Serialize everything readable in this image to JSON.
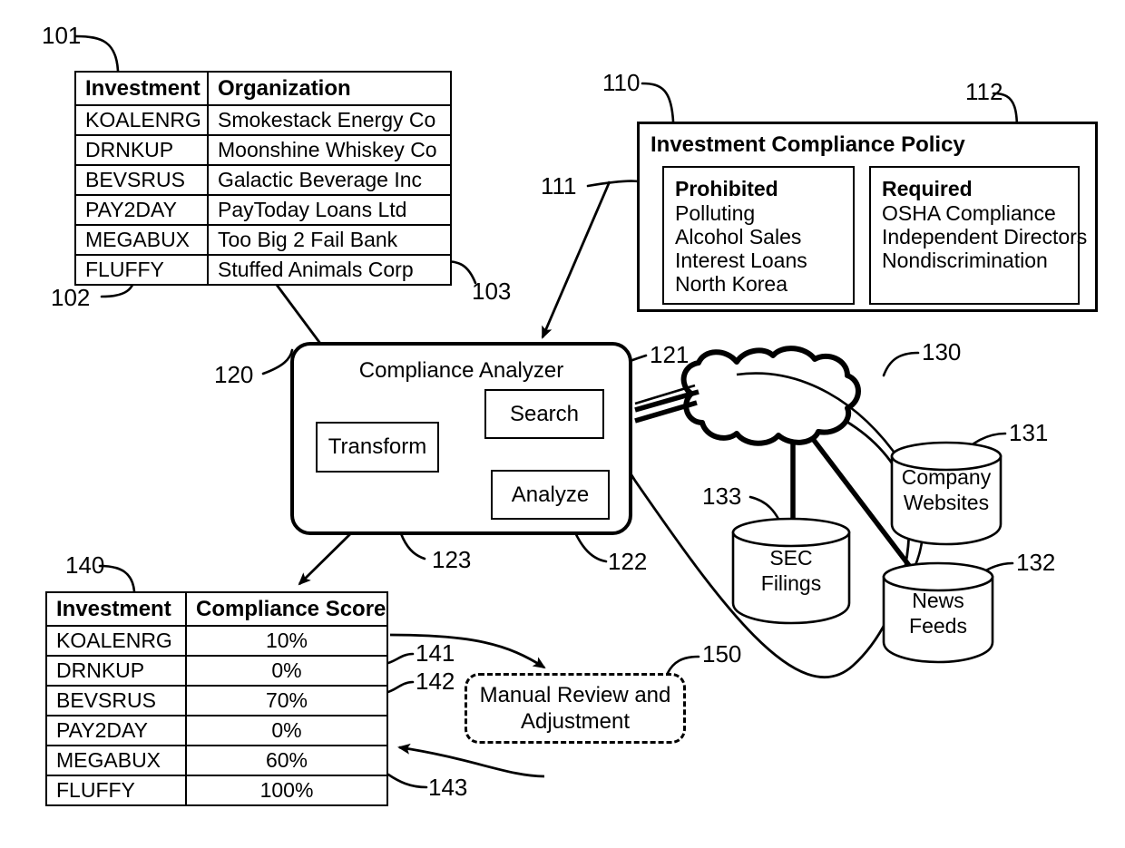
{
  "figure": {
    "type": "patent-flow-diagram",
    "investment_table": {
      "ref": "101",
      "ref_left": "102",
      "ref_right": "103",
      "headers": [
        "Investment",
        "Organization"
      ],
      "rows": [
        [
          "KOALENRG",
          "Smokestack Energy Co"
        ],
        [
          "DRNKUP",
          "Moonshine Whiskey Co"
        ],
        [
          "BEVSRUS",
          "Galactic Beverage Inc"
        ],
        [
          "PAY2DAY",
          "PayToday Loans Ltd"
        ],
        [
          "MEGABUX",
          "Too Big 2 Fail Bank"
        ],
        [
          "FLUFFY",
          "Stuffed Animals Corp"
        ]
      ]
    },
    "policy": {
      "ref": "110",
      "title": "Investment Compliance Policy",
      "prohibited": {
        "ref": "111",
        "heading": "Prohibited",
        "items": [
          "Polluting",
          "Alcohol Sales",
          "Interest Loans",
          "North Korea"
        ]
      },
      "required": {
        "ref": "112",
        "heading": "Required",
        "items": [
          "OSHA Compliance",
          "Independent Directors",
          "Nondiscrimination"
        ]
      }
    },
    "analyzer": {
      "ref": "120",
      "title": "Compliance Analyzer",
      "blocks": [
        {
          "ref": "121",
          "label": "Search"
        },
        {
          "ref": "122",
          "label": "Analyze"
        },
        {
          "ref": "123",
          "label": "Transform"
        }
      ]
    },
    "network": {
      "ref": "130",
      "label": "cloud-network"
    },
    "sources": [
      {
        "ref": "131",
        "line1": "Company",
        "line2": "Websites"
      },
      {
        "ref": "132",
        "line1": "News",
        "line2": "Feeds"
      },
      {
        "ref": "133",
        "line1": "SEC",
        "line2": "Filings"
      }
    ],
    "score_table": {
      "ref": "140",
      "row_refs": [
        "141",
        "142",
        "143"
      ],
      "headers": [
        "Investment",
        "Compliance Score"
      ],
      "rows": [
        [
          "KOALENRG",
          "10%"
        ],
        [
          "DRNKUP",
          "0%"
        ],
        [
          "BEVSRUS",
          "70%"
        ],
        [
          "PAY2DAY",
          "0%"
        ],
        [
          "MEGABUX",
          "60%"
        ],
        [
          "FLUFFY",
          "100%"
        ]
      ]
    },
    "manual_review": {
      "ref": "150",
      "line1": "Manual Review and",
      "line2": "Adjustment"
    }
  }
}
